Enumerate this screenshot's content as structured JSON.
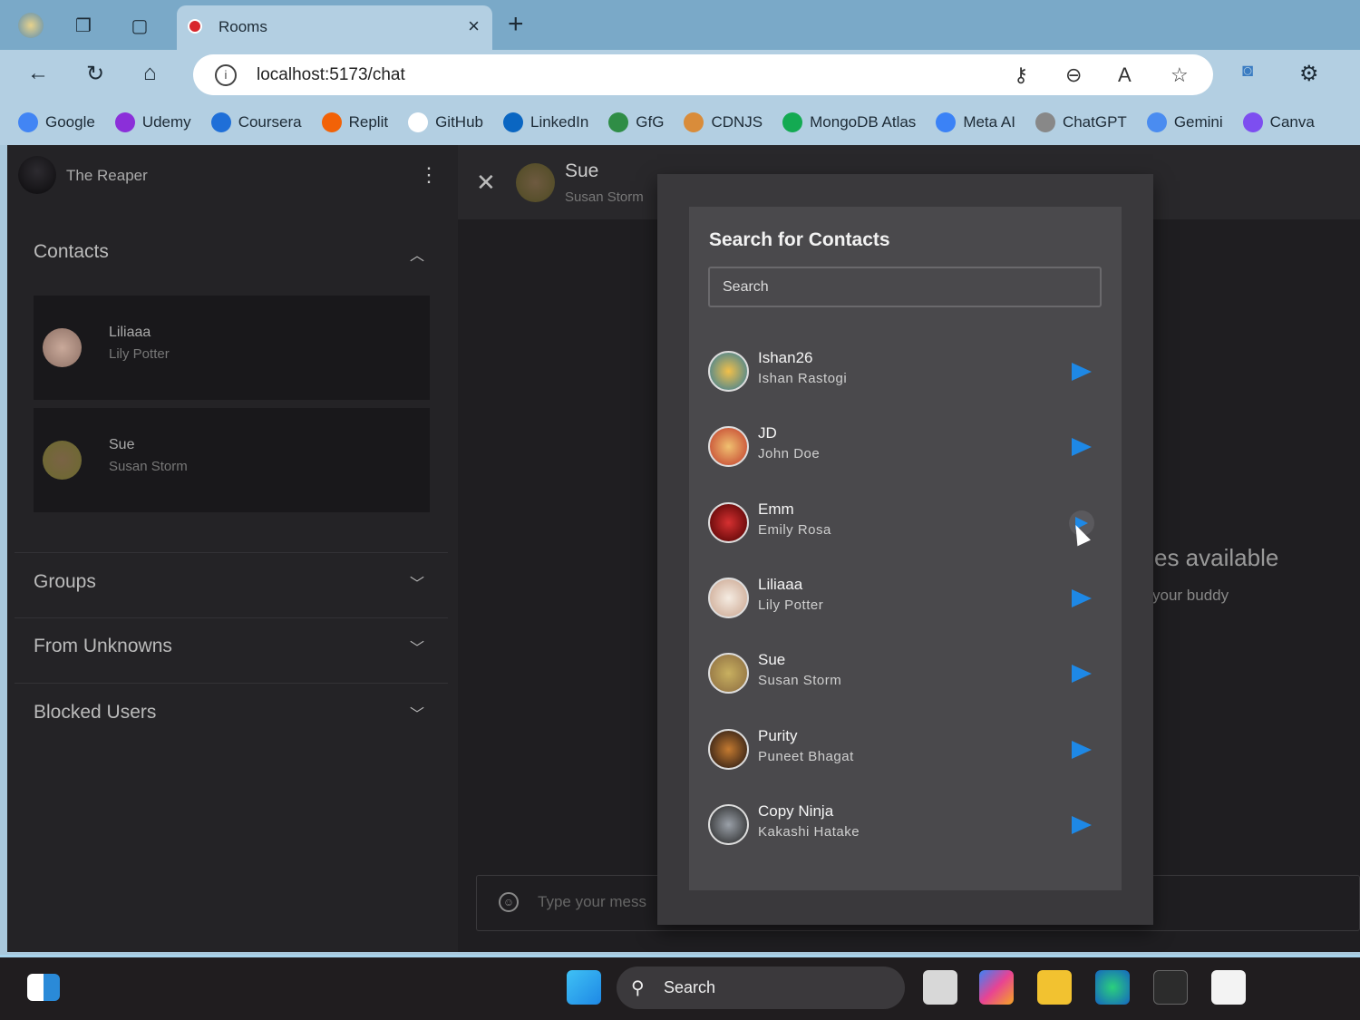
{
  "browser": {
    "tab_title": "Rooms",
    "url": "localhost:5173/chat",
    "bookmarks": [
      {
        "label": "Google",
        "color": "#4285f4"
      },
      {
        "label": "Udemy",
        "color": "#8b2fd9"
      },
      {
        "label": "Coursera",
        "color": "#1f6fd8"
      },
      {
        "label": "Replit",
        "color": "#f26207"
      },
      {
        "label": "GitHub",
        "color": "#ffffff"
      },
      {
        "label": "LinkedIn",
        "color": "#0a66c2"
      },
      {
        "label": "GfG",
        "color": "#2f8d46"
      },
      {
        "label": "CDNJS",
        "color": "#d98c3a"
      },
      {
        "label": "MongoDB Atlas",
        "color": "#13aa52"
      },
      {
        "label": "Meta AI",
        "color": "#3b82f6"
      },
      {
        "label": "ChatGPT",
        "color": "#888888"
      },
      {
        "label": "Gemini",
        "color": "#4a8cf0"
      },
      {
        "label": "Canva",
        "color": "#7d4ef0"
      }
    ]
  },
  "sidebar": {
    "user_name": "The Reaper",
    "sections": {
      "contacts": "Contacts",
      "groups": "Groups",
      "unknowns": "From Unknowns",
      "blocked": "Blocked Users"
    },
    "contacts": [
      {
        "name": "Liliaaa",
        "full_name": "Lily Potter"
      },
      {
        "name": "Sue",
        "full_name": "Susan Storm"
      }
    ]
  },
  "chat": {
    "name": "Sue",
    "full_name": "Susan Storm",
    "empty_title_visible": "es available",
    "empty_sub_visible": "your buddy",
    "input_placeholder_visible": "Type your mess"
  },
  "modal": {
    "title": "Search for Contacts",
    "search_placeholder": "Search",
    "results": [
      {
        "name": "Ishan26",
        "full_name": "Ishan Rastogi"
      },
      {
        "name": "JD",
        "full_name": "John Doe"
      },
      {
        "name": "Emm",
        "full_name": "Emily Rosa"
      },
      {
        "name": "Liliaaa",
        "full_name": "Lily Potter"
      },
      {
        "name": "Sue",
        "full_name": "Susan Storm"
      },
      {
        "name": "Purity",
        "full_name": "Puneet Bhagat"
      },
      {
        "name": "Copy Ninja",
        "full_name": "Kakashi Hatake"
      }
    ],
    "accent": "#1e88e5"
  },
  "taskbar": {
    "search_label": "Search"
  }
}
